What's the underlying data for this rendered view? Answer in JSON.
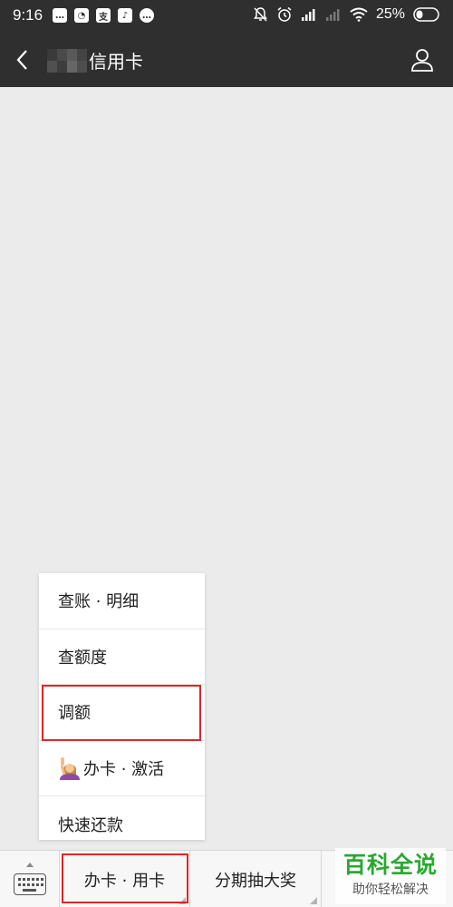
{
  "status_bar": {
    "time": "9:16",
    "battery_percent": "25%",
    "left_icons": [
      "message-icon",
      "wechat-icon",
      "alipay-icon",
      "tiktok-icon",
      "chat-bubble-icon"
    ],
    "right_icons": [
      "mute-bell-icon",
      "alarm-icon",
      "signal-icon",
      "signal-weak-icon",
      "wifi-icon",
      "battery-icon"
    ]
  },
  "header": {
    "title": "信用卡",
    "back_icon": "chevron-left-icon",
    "profile_icon": "person-icon"
  },
  "popup_menu": {
    "items": [
      {
        "label": "查账 · 明细"
      },
      {
        "label": "查额度"
      },
      {
        "label": "调额"
      },
      {
        "label": "办卡 · 激活"
      },
      {
        "label": "快速还款"
      }
    ],
    "highlight_color": "#e0252a"
  },
  "bottom_menu": {
    "keyboard_icon": "keyboard-icon",
    "tabs": [
      {
        "label": "办卡 · 用卡"
      },
      {
        "label": "分期抽大奖"
      }
    ]
  },
  "watermark": {
    "title": "百科全说",
    "subtitle": "助你轻松解决"
  },
  "colors": {
    "header_bg": "#2f2f2f",
    "page_bg": "#ebebeb",
    "highlight": "#e0252a",
    "watermark_green": "#2aa832"
  }
}
